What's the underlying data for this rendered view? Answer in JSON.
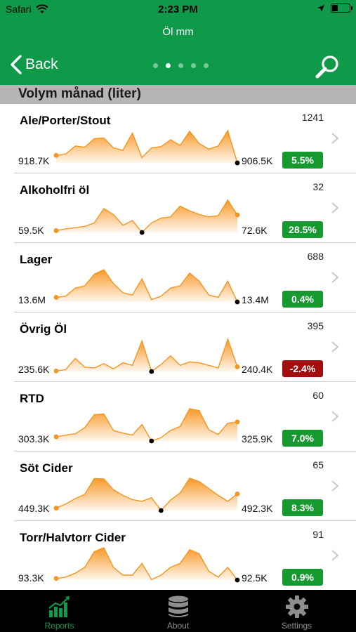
{
  "status_bar": {
    "carrier": "Safari",
    "time": "2:23 PM"
  },
  "header": {
    "title": "Öl mm",
    "back_label": "Back",
    "page_count": 5,
    "active_page": 1
  },
  "section": {
    "title": "Volym månad (liter)"
  },
  "colors": {
    "brand_green": "#0f9a49",
    "spark_orange": "#f7941d",
    "positive_badge": "#169a30",
    "negative_badge": "#a40d0d"
  },
  "rows": [
    {
      "name": "Ale/Porter/Stout",
      "count": "1241",
      "start": "918.7K",
      "end": "906.5K",
      "change": "5.5%",
      "direction": "up",
      "series": [
        918.7,
        921,
        934,
        932,
        946,
        947,
        931,
        927,
        955,
        915,
        931,
        933,
        944,
        935,
        958,
        938,
        929,
        934,
        959,
        906.5
      ]
    },
    {
      "name": "Alkoholfri öl",
      "count": "32",
      "start": "59.5K",
      "end": "72.6K",
      "change": "28.5%",
      "direction": "up",
      "series": [
        59.5,
        61,
        62,
        63,
        66,
        78,
        73,
        64,
        68,
        58,
        66,
        70,
        71,
        80,
        76,
        73,
        71,
        72,
        85,
        72.6
      ]
    },
    {
      "name": "Lager",
      "count": "688",
      "start": "13.6M",
      "end": "13.4M",
      "change": "0.4%",
      "direction": "up",
      "series": [
        13.6,
        13.65,
        14.0,
        14.1,
        14.6,
        14.8,
        14.2,
        13.8,
        13.7,
        14.4,
        13.5,
        13.65,
        14.0,
        14.1,
        14.65,
        14.3,
        13.7,
        13.6,
        14.3,
        13.4
      ]
    },
    {
      "name": "Övrig Öl",
      "count": "395",
      "start": "235.6K",
      "end": "240.4K",
      "change": "-2.4%",
      "direction": "down",
      "series": [
        235.6,
        237,
        250,
        240,
        239,
        244,
        238,
        245,
        242,
        270,
        235,
        243,
        253,
        242,
        246,
        245,
        242,
        239,
        272,
        240.4
      ]
    },
    {
      "name": "RTD",
      "count": "60",
      "start": "303.3K",
      "end": "325.9K",
      "change": "7.0%",
      "direction": "up",
      "series": [
        303.3,
        306,
        308,
        317,
        337,
        338,
        313,
        309,
        306,
        322,
        297,
        302,
        313,
        319,
        346,
        343,
        314,
        307,
        324,
        325.9
      ]
    },
    {
      "name": "Söt Cider",
      "count": "65",
      "start": "449.3K",
      "end": "492.3K",
      "change": "8.3%",
      "direction": "up",
      "series": [
        449.3,
        462,
        478,
        491,
        539,
        538,
        505,
        488,
        475,
        470,
        481,
        442,
        474,
        495,
        540,
        530,
        509,
        488,
        470,
        492.3
      ]
    },
    {
      "name": "Torr/Halvtorr Cider",
      "count": "91",
      "start": "93.3K",
      "end": "92.5K",
      "change": "0.9%",
      "direction": "up",
      "series": [
        93.3,
        94,
        96,
        99,
        107,
        109,
        99,
        95,
        95,
        101,
        92.7,
        95,
        99,
        101,
        108,
        106,
        97,
        94,
        99,
        92.5
      ]
    }
  ],
  "tabs": [
    {
      "label": "Reports",
      "icon": "bar-chart-icon",
      "active": true
    },
    {
      "label": "About",
      "icon": "database-icon",
      "active": false
    },
    {
      "label": "Settings",
      "icon": "gear-icon",
      "active": false
    }
  ]
}
